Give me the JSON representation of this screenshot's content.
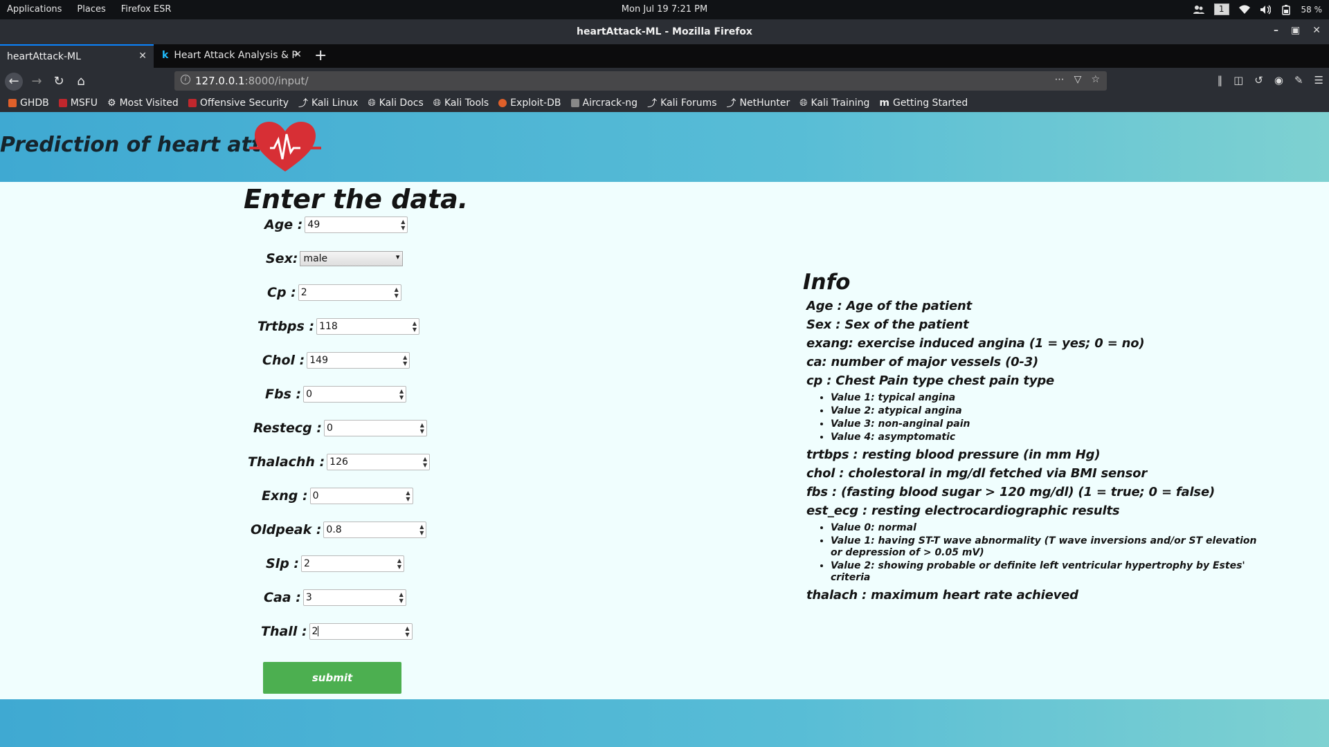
{
  "system": {
    "menu": [
      "Applications",
      "Places",
      "Firefox ESR"
    ],
    "clock": "Mon Jul 19   7:21 PM",
    "workspace": "1",
    "battery": "58 %"
  },
  "window": {
    "title": "heartAttack-ML - Mozilla Firefox"
  },
  "tabs": [
    {
      "label": "heartAttack-ML"
    },
    {
      "label": "Heart Attack Analysis & P"
    }
  ],
  "urlbar": {
    "host": "127.0.0.1",
    "path": ":8000/input/"
  },
  "bookmarks": [
    {
      "label": "GHDB",
      "color": "#e0602a"
    },
    {
      "label": "MSFU",
      "color": "#c0272d"
    },
    {
      "label": "Most Visited",
      "color": "#cccccc"
    },
    {
      "label": "Offensive Security",
      "color": "#c0272d"
    },
    {
      "label": "Kali Linux",
      "color": "#3a8ad6"
    },
    {
      "label": "Kali Docs",
      "color": "#cccccc"
    },
    {
      "label": "Kali Tools",
      "color": "#cccccc"
    },
    {
      "label": "Exploit-DB",
      "color": "#e0602a"
    },
    {
      "label": "Aircrack-ng",
      "color": "#888888"
    },
    {
      "label": "Kali Forums",
      "color": "#3a8ad6"
    },
    {
      "label": "NetHunter",
      "color": "#3a8ad6"
    },
    {
      "label": "Kali Training",
      "color": "#cccccc"
    },
    {
      "label": "Getting Started",
      "color": "#ffffff"
    }
  ],
  "page": {
    "header_title": "Prediction of heart attack",
    "form_title": "Enter the data.",
    "fields": {
      "age": {
        "label": "Age :",
        "value": "49"
      },
      "sex": {
        "label": "Sex:",
        "value": "male"
      },
      "cp": {
        "label": "Cp :",
        "value": "2"
      },
      "trtbps": {
        "label": "Trtbps :",
        "value": "118"
      },
      "chol": {
        "label": "Chol :",
        "value": "149"
      },
      "fbs": {
        "label": "Fbs :",
        "value": "0"
      },
      "restecg": {
        "label": "Restecg :",
        "value": "0"
      },
      "thalachh": {
        "label": "Thalachh :",
        "value": "126"
      },
      "exng": {
        "label": "Exng :",
        "value": "0"
      },
      "oldpeak": {
        "label": "Oldpeak :",
        "value": "0.8"
      },
      "slp": {
        "label": "Slp :",
        "value": "2"
      },
      "caa": {
        "label": "Caa :",
        "value": "3"
      },
      "thall": {
        "label": "Thall :",
        "value": "2"
      }
    },
    "submit_label": "submit",
    "info": {
      "title": "Info",
      "age": "Age : Age of the patient",
      "sex": "Sex : Sex of the patient",
      "exang": "exang: exercise induced angina (1 = yes; 0 = no)",
      "ca": "ca: number of major vessels (0-3)",
      "cp": "cp : Chest Pain type chest pain type",
      "cp_values": [
        "Value 1: typical angina",
        "Value 2: atypical angina",
        "Value 3: non-anginal pain",
        "Value 4: asymptomatic"
      ],
      "trtbps": "trtbps : resting blood pressure (in mm Hg)",
      "chol": "chol : cholestoral in mg/dl fetched via BMI sensor",
      "fbs": "fbs : (fasting blood sugar > 120 mg/dl) (1 = true; 0 = false)",
      "rest_ecg": "est_ecg : resting electrocardiographic results",
      "ecg_values": [
        "Value 0: normal",
        "Value 1: having ST-T wave abnormality (T wave inversions and/or ST elevation or depression of > 0.05 mV)",
        "Value 2: showing probable or definite left ventricular hypertrophy by Estes' criteria"
      ],
      "thalach": "thalach : maximum heart rate achieved"
    }
  }
}
